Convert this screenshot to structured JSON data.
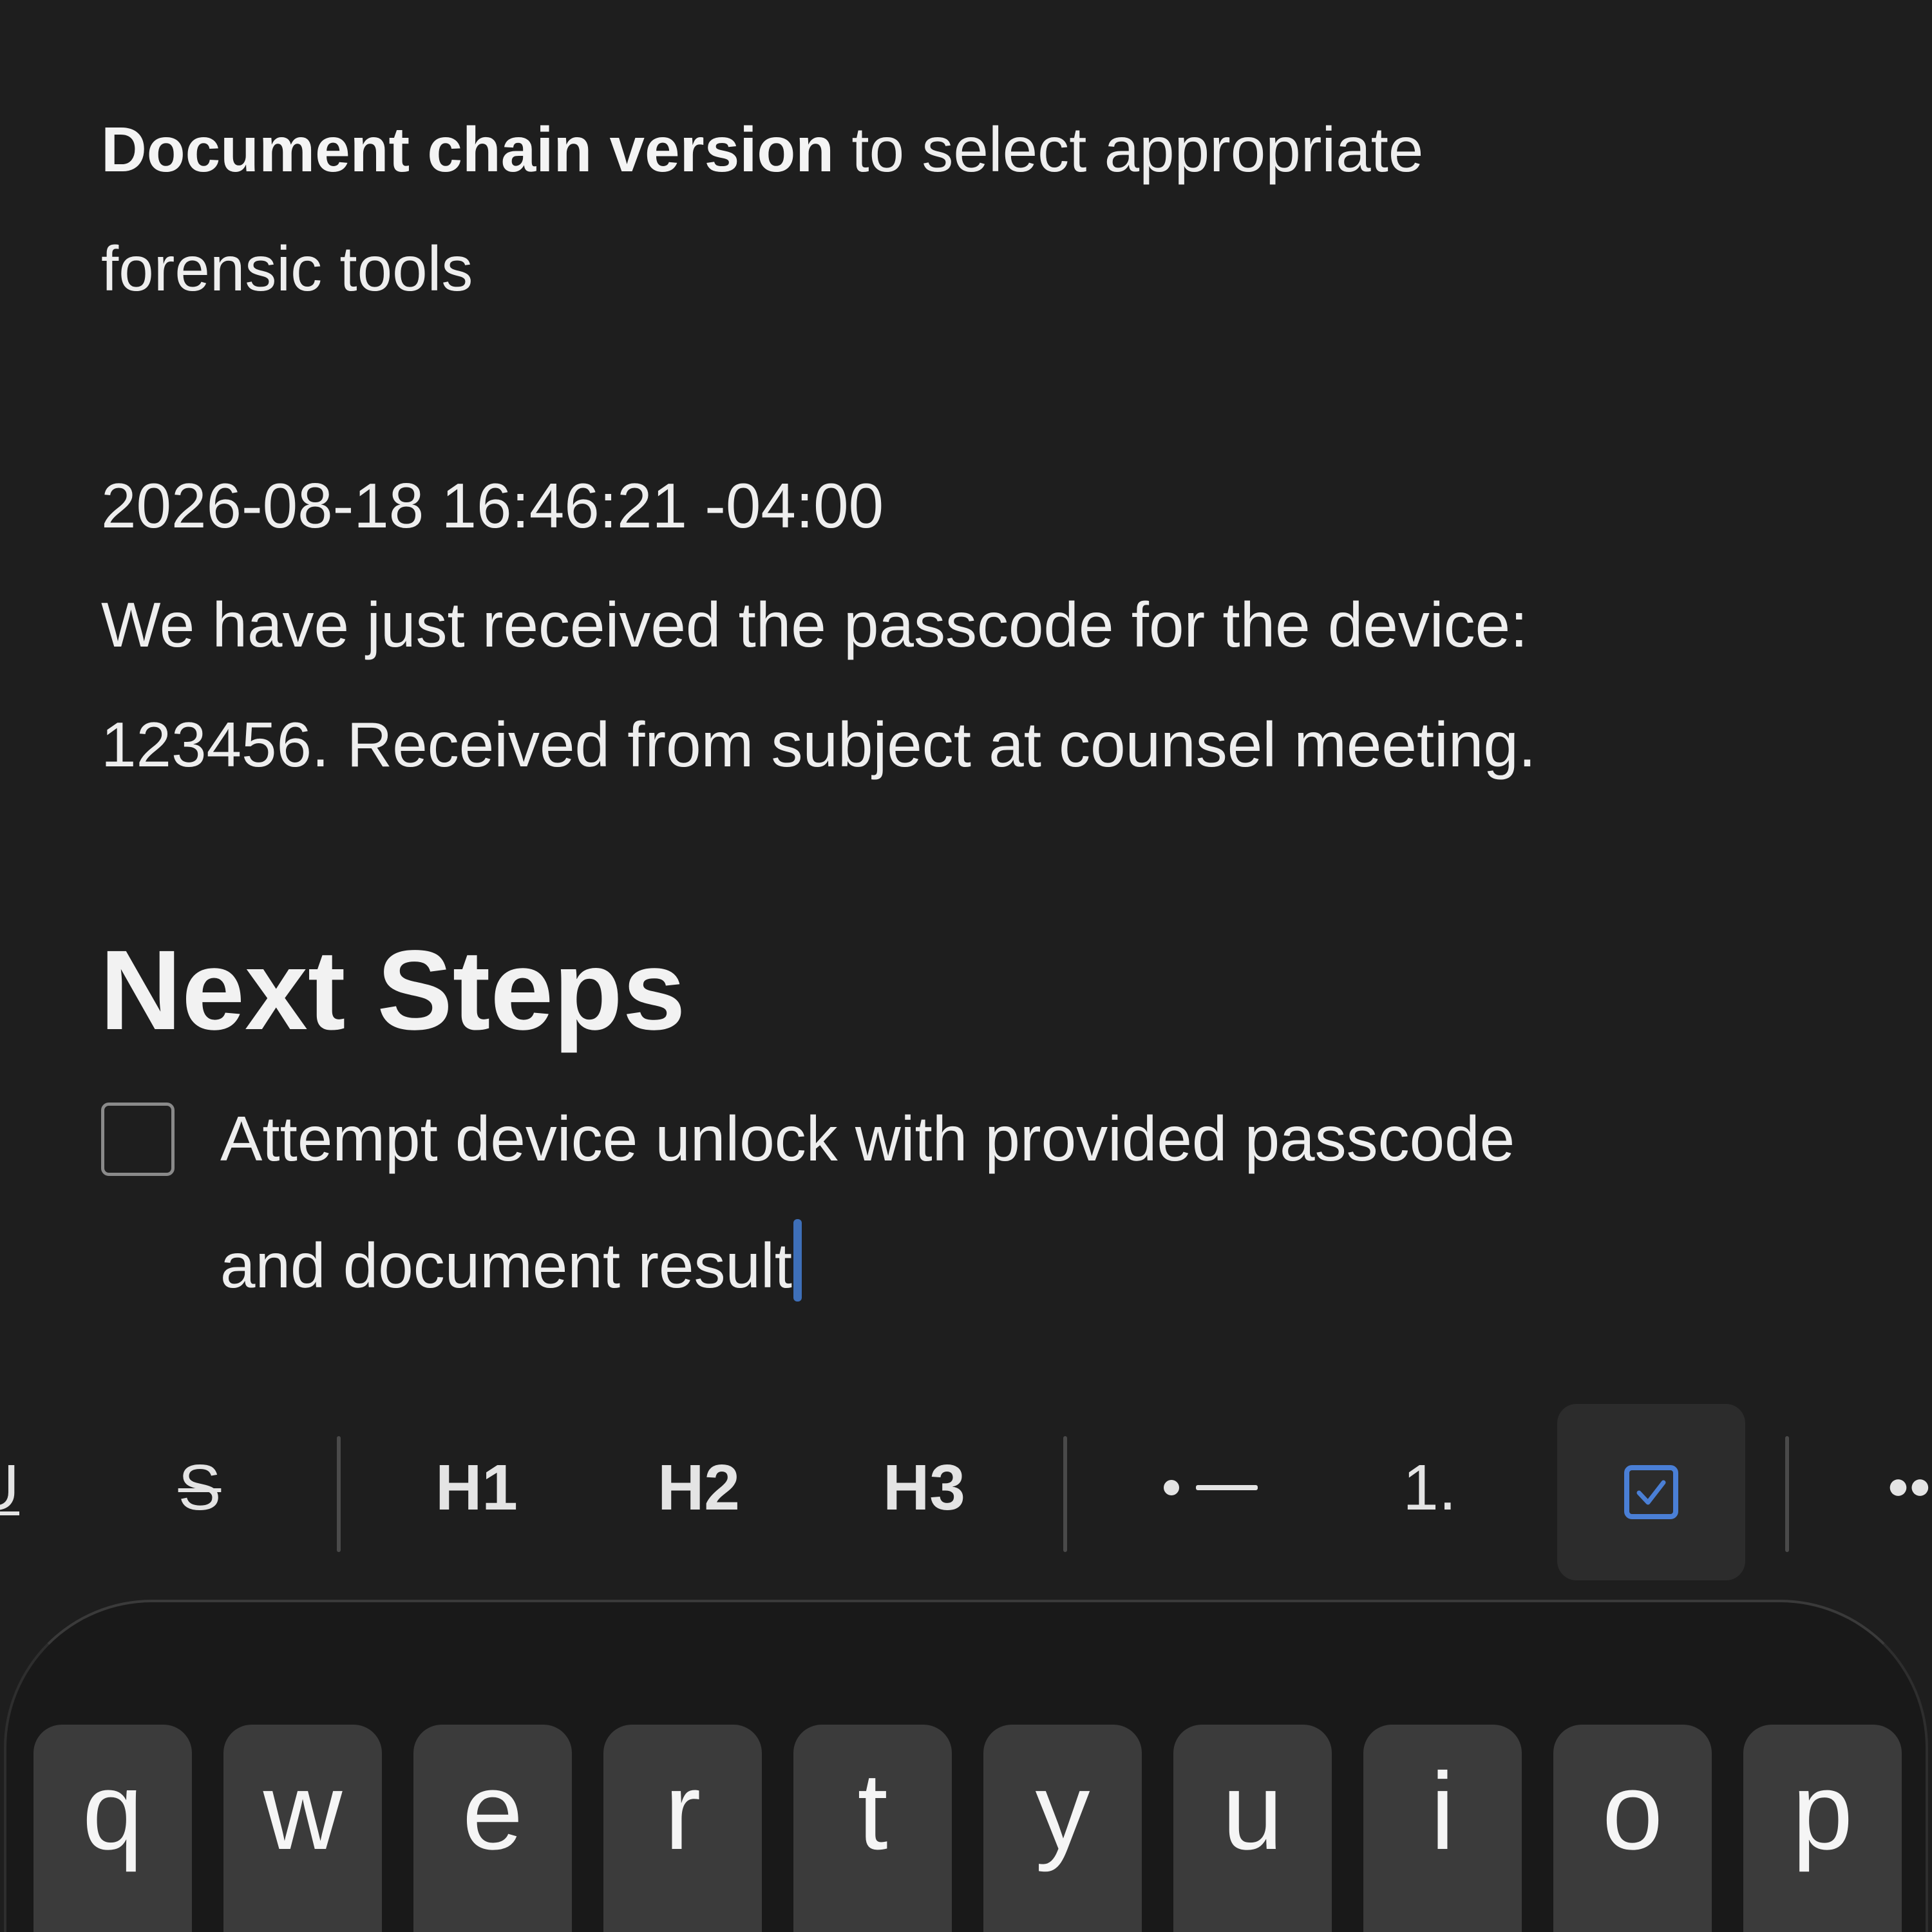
{
  "note": {
    "para1_bold": "Document chain version",
    "para1_rest": " to select appropriate",
    "para1_line2": "forensic tools",
    "timestamp": "2026-08-18 16:46:21 -04:00",
    "para2_line1": "We have just received the passcode for the device:",
    "para2_line2": "123456. Received from subject at counsel meeting.",
    "heading": "Next Steps",
    "todo": {
      "checked": false,
      "line1": "Attempt device unlock with provided passcode",
      "line2": "and document result"
    }
  },
  "toolbar": {
    "underline_partial": "U",
    "strike": "S",
    "h1": "H1",
    "h2": "H2",
    "h3": "H3",
    "bullet_icon": "bulleted-list-icon",
    "numbered": "1.",
    "checklist_icon": "checklist-icon",
    "quote_icon": "quote-icon",
    "active_tool": "checklist"
  },
  "keyboard": {
    "row1": [
      "q",
      "w",
      "e",
      "r",
      "t",
      "y",
      "u",
      "i",
      "o",
      "p"
    ]
  },
  "colors": {
    "background": "#1e1e1e",
    "text": "#eeeeee",
    "caret": "#3e6fb8",
    "checklist_accent": "#4a7fd6",
    "key": "#3b3b3b"
  }
}
